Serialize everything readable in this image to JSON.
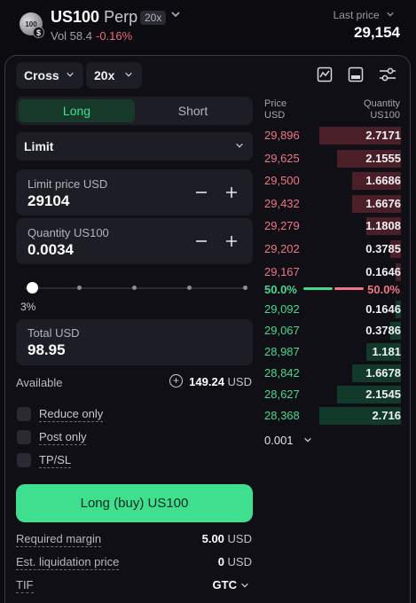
{
  "header": {
    "coin_text": "100",
    "coin_badge": "$",
    "symbol": "US100",
    "suffix": "Perp",
    "leverage_badge": "20x",
    "volume": "Vol 58.4",
    "change": "-0.16%",
    "last_price_label": "Last price",
    "last_price": "29,154"
  },
  "controls": {
    "margin_mode": "Cross",
    "leverage": "20x",
    "icons": [
      "chart-icon",
      "layout-icon",
      "settings-sliders-icon"
    ]
  },
  "side_tabs": {
    "long": "Long",
    "short": "Short",
    "active": "long"
  },
  "order_type": "Limit",
  "limit_price": {
    "label": "Limit price USD",
    "value": "29104"
  },
  "quantity": {
    "label": "Quantity US100",
    "value": "0.0034"
  },
  "slider": {
    "percent_label": "3%",
    "value": 0.03
  },
  "total": {
    "label": "Total USD",
    "value": "98.95"
  },
  "available": {
    "label": "Available",
    "value": "149.24",
    "unit": "USD"
  },
  "options": [
    "Reduce only",
    "Post only",
    "TP/SL"
  ],
  "submit_label": "Long (buy) US100",
  "info": {
    "required_margin_label": "Required margin",
    "required_margin_value": "5.00",
    "required_margin_unit": "USD",
    "liq_label": "Est. liquidation price",
    "liq_value": "0",
    "liq_unit": "USD",
    "tif_label": "TIF",
    "tif_value": "GTC"
  },
  "orderbook": {
    "price_header": "Price",
    "price_unit": "USD",
    "qty_header": "Quantity",
    "qty_unit": "US100",
    "asks": [
      {
        "price": "29,896",
        "qty": "2.7171",
        "depth": 1.0
      },
      {
        "price": "29,625",
        "qty": "2.1555",
        "depth": 0.78
      },
      {
        "price": "29,500",
        "qty": "1.6686",
        "depth": 0.6
      },
      {
        "price": "29,432",
        "qty": "1.6676",
        "depth": 0.6
      },
      {
        "price": "29,279",
        "qty": "1.1808",
        "depth": 0.42
      },
      {
        "price": "29,202",
        "qty": "0.3785",
        "depth": 0.13
      },
      {
        "price": "29,167",
        "qty": "0.1646",
        "depth": 0.06
      }
    ],
    "ratio_long": "50.0%",
    "ratio_short": "50.0%",
    "bids": [
      {
        "price": "29,092",
        "qty": "0.1646",
        "depth": 0.06
      },
      {
        "price": "29,067",
        "qty": "0.3786",
        "depth": 0.13
      },
      {
        "price": "28,987",
        "qty": "1.181",
        "depth": 0.42
      },
      {
        "price": "28,842",
        "qty": "1.6678",
        "depth": 0.6
      },
      {
        "price": "28,627",
        "qty": "2.1545",
        "depth": 0.78
      },
      {
        "price": "28,368",
        "qty": "2.716",
        "depth": 1.0
      }
    ],
    "tick_size": "0.001"
  },
  "colors": {
    "accent": "#3ee08f",
    "ask": "#f07683",
    "bid": "#46d98c"
  }
}
